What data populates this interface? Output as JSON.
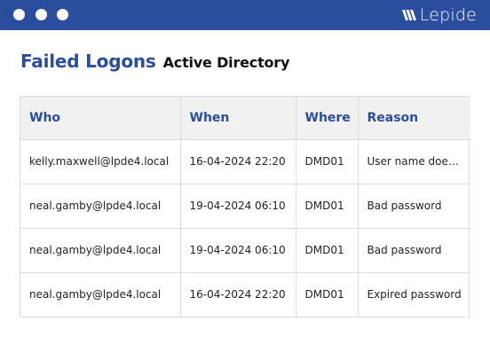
{
  "window": {
    "brand": "Lepide",
    "brand_logo_icon": "lepide-stripes-logo",
    "accent_color": "#2b4d9e"
  },
  "heading": {
    "title": "Failed Logons",
    "subtitle": "Active Directory"
  },
  "table": {
    "columns": [
      "Who",
      "When",
      "Where",
      "Reason"
    ],
    "rows": [
      [
        "kelly.maxwell@lpde4.local",
        "16-04-2024 22:20",
        "DMD01",
        "User name does n..."
      ],
      [
        "neal.gamby@lpde4.local",
        "19-04-2024 06:10",
        "DMD01",
        "Bad password"
      ],
      [
        "neal.gamby@lpde4.local",
        "19-04-2024 06:10",
        "DMD01",
        "Bad password"
      ],
      [
        "neal.gamby@lpde4.local",
        "16-04-2024 22:20",
        "DMD01",
        "Expired password"
      ]
    ]
  }
}
